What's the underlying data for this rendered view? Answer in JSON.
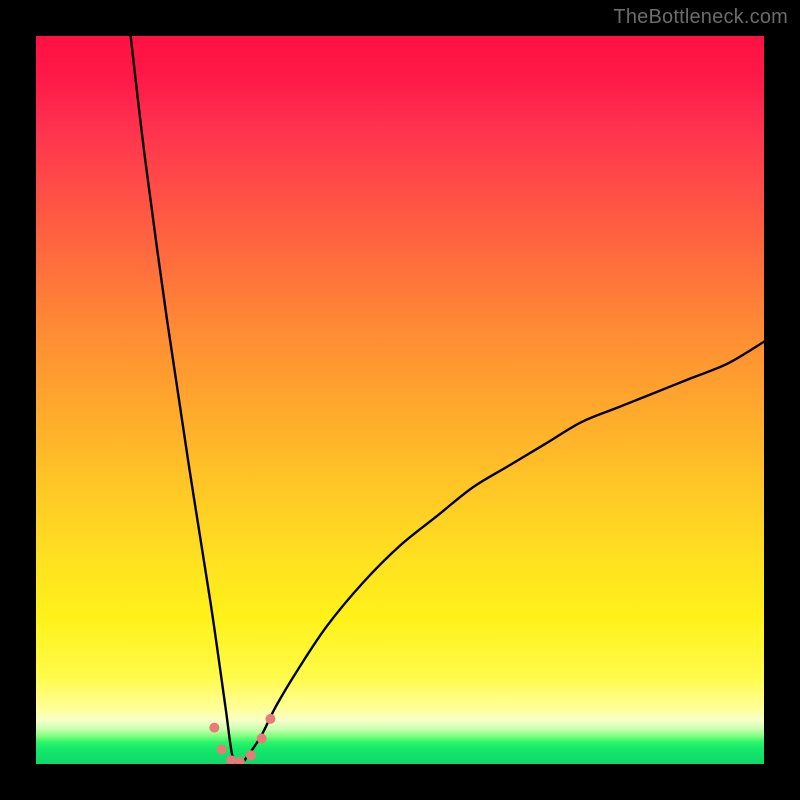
{
  "watermark": "TheBottleneck.com",
  "colors": {
    "background": "#000000",
    "gradient_top": "#ff1142",
    "gradient_mid": "#ffe120",
    "gradient_pale": "#ffff9c",
    "gradient_green": "#14e86a",
    "curve": "#000000",
    "markers": "#e97a78"
  },
  "chart_data": {
    "type": "line",
    "title": "",
    "xlabel": "",
    "ylabel": "",
    "xlim": [
      0,
      100
    ],
    "ylim": [
      0,
      100
    ],
    "note": "V-shaped bottleneck curve. Minimum near x≈27 at y≈0; left branch nearly vertical rising to y≈100 at x≈13; right branch rises concavely to y≈58 at x=100.",
    "series": [
      {
        "name": "bottleneck-curve",
        "x": [
          13,
          15,
          18,
          21,
          24,
          26,
          27,
          28,
          29,
          31,
          33,
          36,
          40,
          45,
          50,
          55,
          60,
          65,
          70,
          75,
          80,
          85,
          90,
          95,
          100
        ],
        "values": [
          100,
          83,
          61,
          41,
          22,
          8,
          1,
          0,
          1,
          4,
          8,
          13,
          19,
          25,
          30,
          34,
          38,
          41,
          44,
          47,
          49,
          51,
          53,
          55,
          58
        ]
      }
    ],
    "markers": [
      {
        "x": 24.5,
        "y": 5
      },
      {
        "x": 25.5,
        "y": 2
      },
      {
        "x": 26.8,
        "y": 0.5
      },
      {
        "x": 28.0,
        "y": 0.3
      },
      {
        "x": 29.5,
        "y": 1.2
      },
      {
        "x": 31.0,
        "y": 3.5
      },
      {
        "x": 32.2,
        "y": 6.2
      }
    ],
    "marker_radius": 5
  }
}
